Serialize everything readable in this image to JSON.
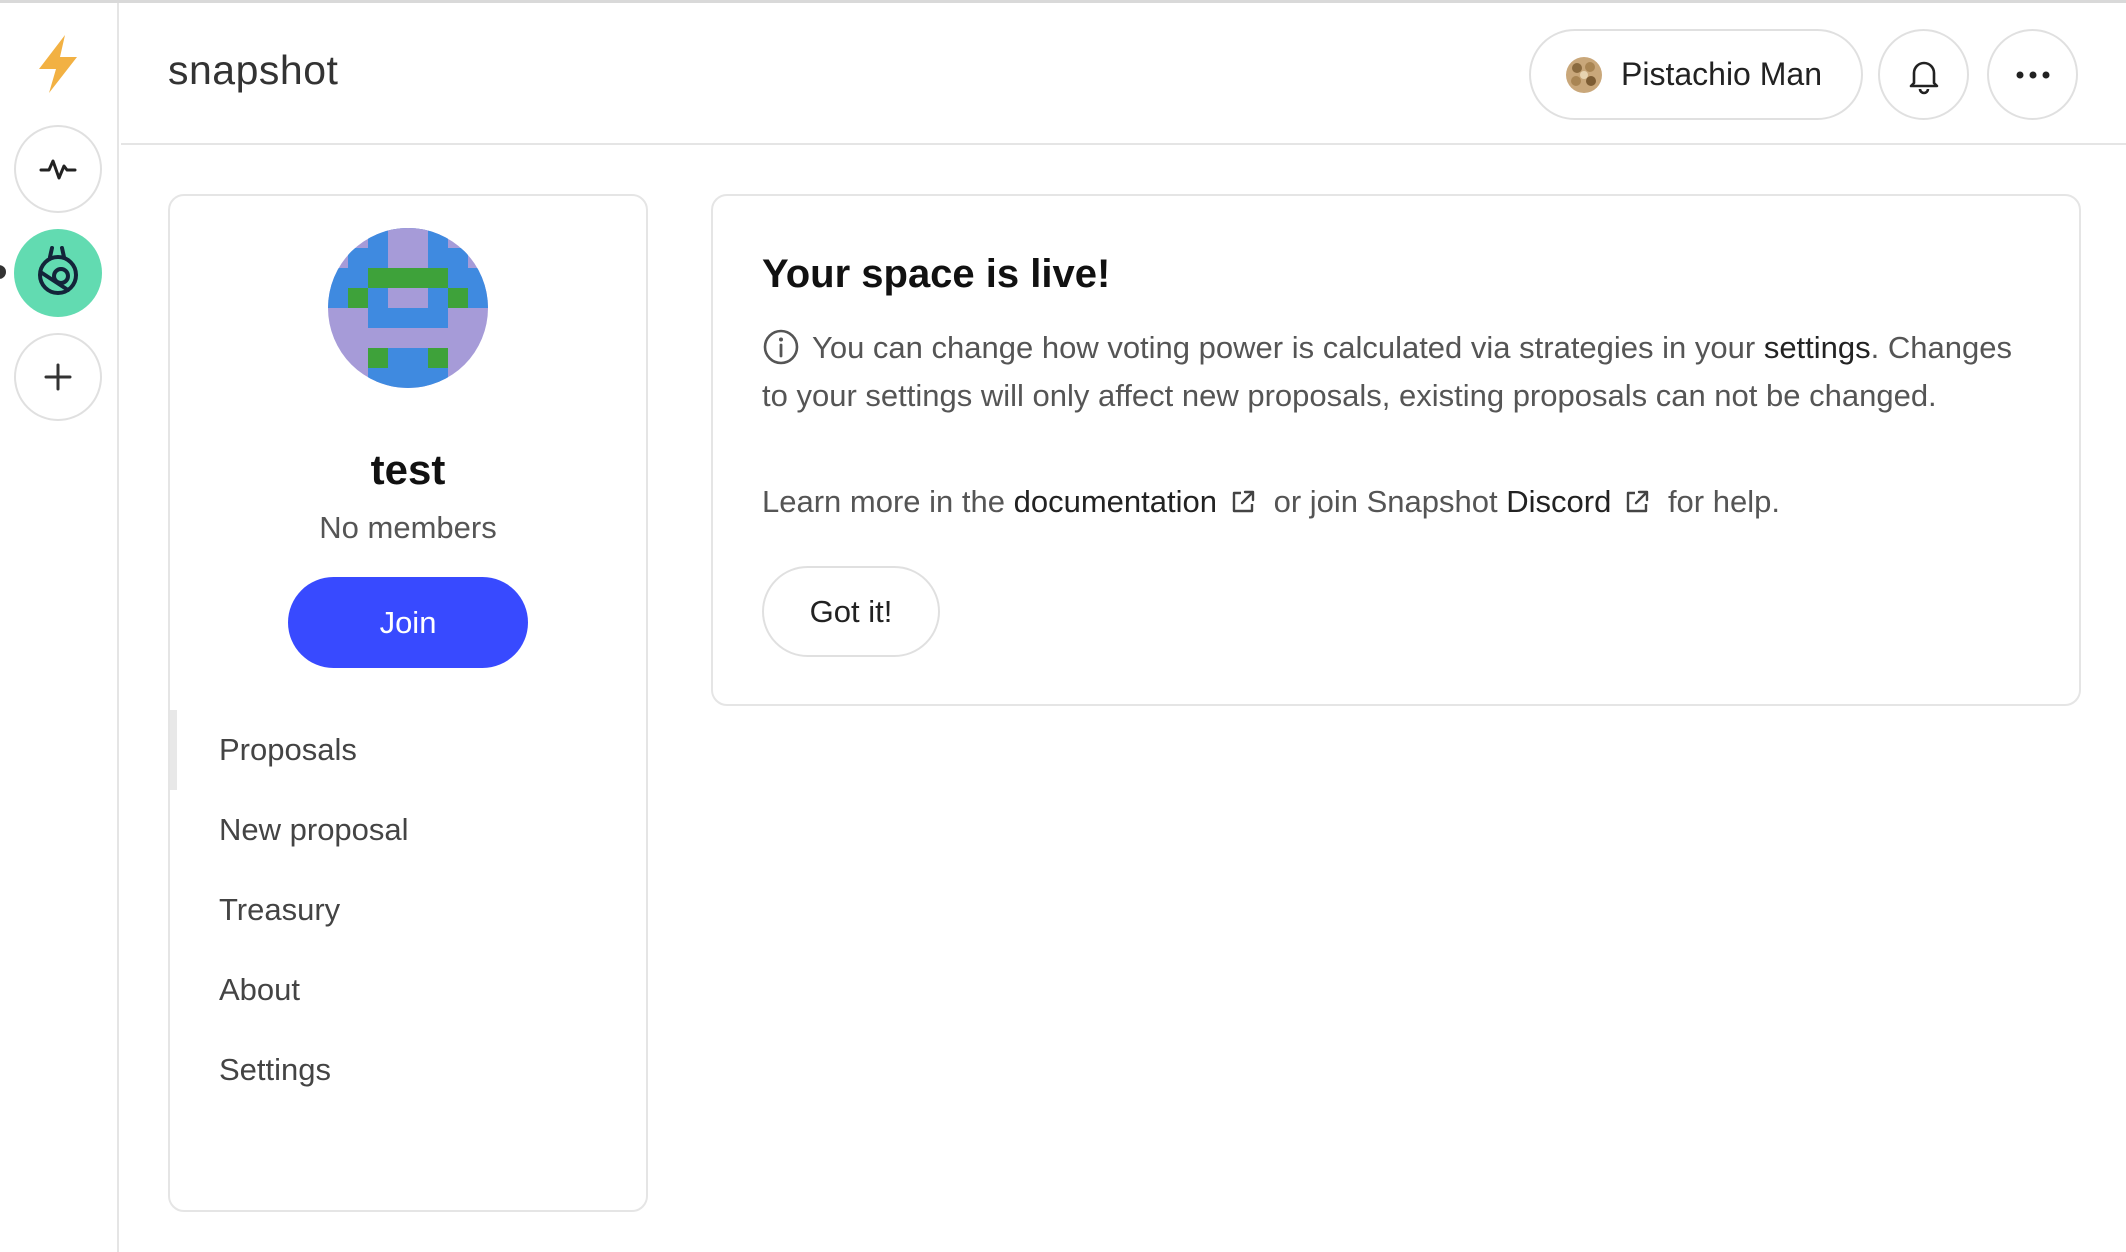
{
  "app": {
    "brand": "snapshot"
  },
  "header": {
    "user_name": "Pistachio Man",
    "user_avatar_icon": "pistachio-avatar-icon",
    "notifications_icon": "bell-icon",
    "more_icon": "more-horizontal-icon"
  },
  "rail": {
    "logo_icon": "lightning-bolt-icon",
    "items": [
      {
        "icon": "activity-icon"
      },
      {
        "icon": "space-avatar-icon",
        "active": true
      },
      {
        "icon": "plus-icon"
      }
    ]
  },
  "space": {
    "name": "test",
    "members": "No members",
    "join_label": "Join",
    "nav": [
      {
        "label": "Proposals",
        "active": true
      },
      {
        "label": "New proposal"
      },
      {
        "label": "Treasury"
      },
      {
        "label": "About"
      },
      {
        "label": "Settings"
      }
    ]
  },
  "notice": {
    "title": "Your space is live!",
    "text_1": "You can change how voting power is calculated via strategies in your ",
    "settings_link": "settings",
    "text_2": ". Changes to your settings will only affect new proposals, existing proposals can not be changed.",
    "learn_prefix": "Learn more in the ",
    "documentation_link": "documentation",
    "learn_middle": " or join Snapshot ",
    "discord_link": "Discord",
    "learn_suffix": " for help.",
    "got_it_label": "Got it!"
  },
  "colors": {
    "primary": "#384aff",
    "space_accent": "#62dbb1",
    "logo": "#f2b143"
  }
}
